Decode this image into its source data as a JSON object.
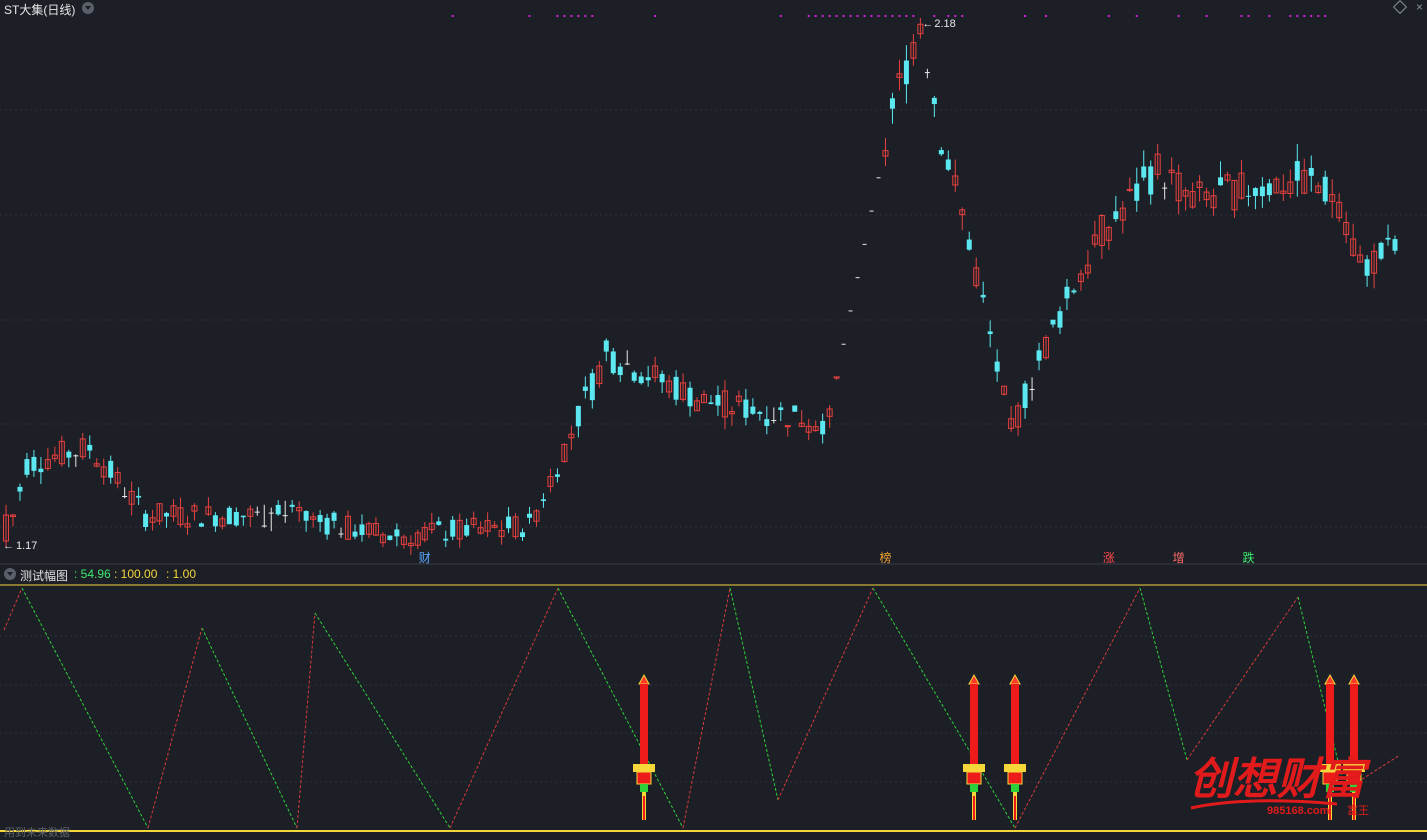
{
  "window": {
    "title": "ST大集(日线)"
  },
  "price_chart": {
    "high_label": "2.18",
    "low_label": "1.17",
    "event_markers": [
      {
        "label": "财",
        "color": "#5aa8ff",
        "day": 60
      },
      {
        "label": "榜",
        "color": "#f0a030",
        "day": 126
      },
      {
        "label": "涨",
        "color": "#ff4a4a",
        "day": 158
      },
      {
        "label": "增",
        "color": "#ff6a6a",
        "day": 168
      },
      {
        "label": "跌",
        "color": "#3ee86f",
        "day": 178
      }
    ],
    "colors": {
      "up": "#e8413f",
      "down": "#5ce8f0",
      "flat": "#e8e8e8",
      "dots": "#d020d8",
      "grid": "#2e323b"
    }
  },
  "indicator": {
    "name": "测试幅图",
    "values": [
      ": 54.96",
      ": 100.00",
      ": 1.00"
    ],
    "top_line": 100,
    "bottom_line": 0
  },
  "footer": {
    "text": "用到未来数据"
  },
  "watermark": {
    "text": "创想财富",
    "url_text": "985168.com",
    "seal_text": "富王"
  }
}
